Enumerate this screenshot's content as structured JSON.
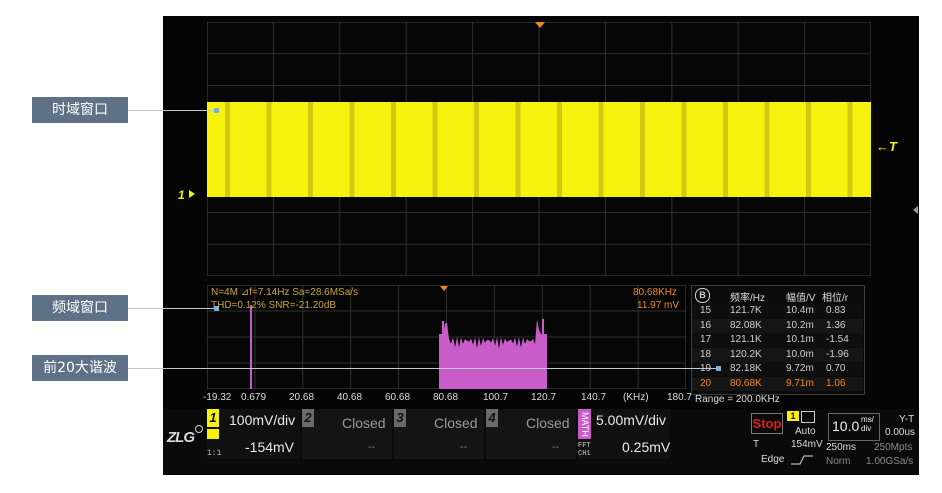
{
  "callouts": {
    "time": "时域窗口",
    "freq": "频域窗口",
    "harm": "前20大谐波"
  },
  "time_window": {
    "trigger_label": "←T",
    "ch1_marker": "1"
  },
  "freq_window": {
    "info_line1": "N=4M  ⊿f=7.14Hz  Sa=28.6MSa/s",
    "info_line2": "THD=0.12%  SNR=-21.20dB",
    "marker_freq": "80.68KHz",
    "marker_amp": "11.97 mV",
    "x_ticks": [
      "-19.32",
      "0.679",
      "20.68",
      "40.68",
      "60.68",
      "80.68",
      "100.7",
      "120.7",
      "140.7",
      "(KHz)",
      "180.7"
    ]
  },
  "harmonics": {
    "icon_label": "B",
    "headers": [
      "频率/Hz",
      "幅值/V",
      "相位/r"
    ],
    "rows": [
      [
        "15",
        "121.7K",
        "10.4m",
        "0.83"
      ],
      [
        "16",
        "82.08K",
        "10.2m",
        "1.36"
      ],
      [
        "17",
        "121.1K",
        "10.1m",
        "-1.54"
      ],
      [
        "18",
        "120.2K",
        "10.0m",
        "-1.96"
      ],
      [
        "19",
        "82.18K",
        "9.72m",
        "0.70"
      ],
      [
        "20",
        "80.68K",
        "9.71m",
        "1.06"
      ]
    ],
    "range": "Range = 200.0KHz"
  },
  "bottom": {
    "logo": "ZLG",
    "ch1": {
      "num": "1",
      "scale": "100mV/div",
      "offset": "-154mV",
      "coupling": "1:1"
    },
    "ch2": {
      "num": "2",
      "status": "Closed",
      "dash": "--"
    },
    "ch3": {
      "num": "3",
      "status": "Closed",
      "dash": "--"
    },
    "ch4": {
      "num": "4",
      "status": "Closed",
      "dash": "--"
    },
    "math": {
      "tag": "MATH",
      "scale": "5.00mV/div",
      "offset": "0.25mV",
      "sub1": "FFT",
      "sub2": "CH1"
    },
    "trigger": {
      "state": "Stop",
      "mode": "Auto",
      "src": "T",
      "level": "154mV",
      "type": "Edge",
      "ch": "1"
    },
    "timebase": {
      "value": "10.0",
      "unit1": "ms/",
      "unit2": "div",
      "mode": "Y-T",
      "delay": "0.00us",
      "acq_time": "250ms",
      "mem": "250Mpts",
      "acq_mode": "Norm",
      "rate": "1.00GSa/s"
    }
  },
  "colors": {
    "ch1": "#f6f20e",
    "fft": "#c95cc8",
    "accent_orange": "#f08a1c",
    "grid": "#3a3a3a",
    "stop": "#e11b1b"
  }
}
